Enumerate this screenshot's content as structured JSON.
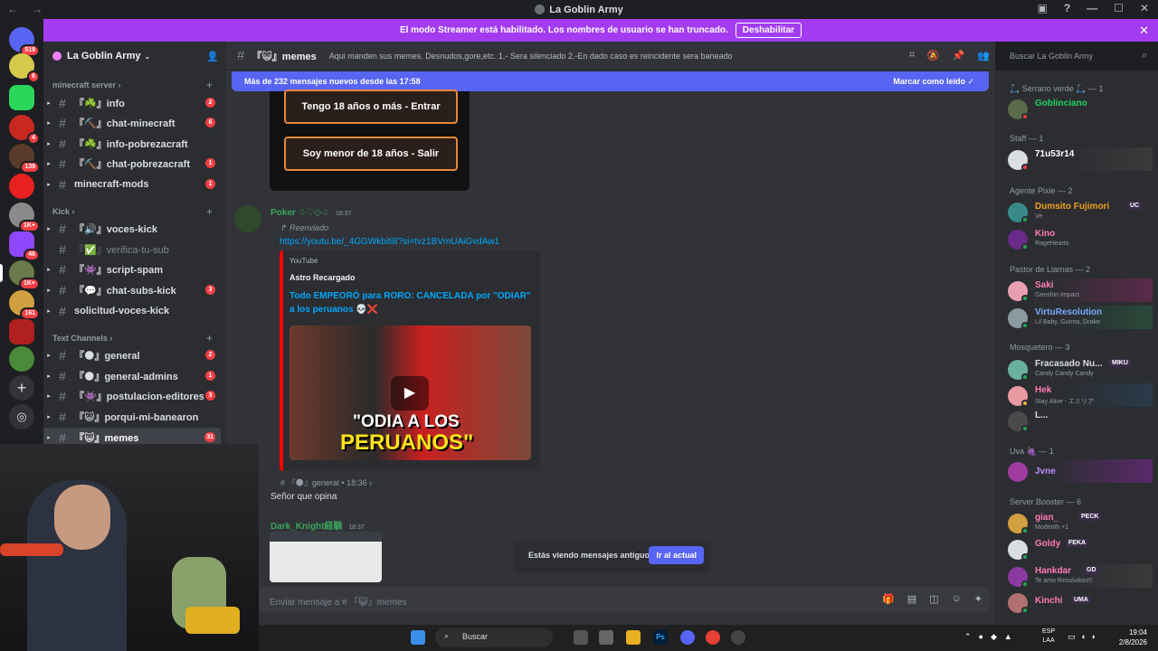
{
  "window": {
    "title": "La Goblin Army"
  },
  "streamer_banner": {
    "text": "El modo Streamer está habilitado. Los nombres de usuario se han truncado.",
    "button": "Deshabilitar"
  },
  "server_rail": [
    {
      "badge": "519"
    },
    {
      "badge": "6"
    },
    {
      "badge": ""
    },
    {
      "badge": "4"
    },
    {
      "badge": "139"
    },
    {
      "badge": ""
    },
    {
      "badge": "1K+"
    },
    {
      "badge": "46"
    },
    {
      "badge": "1K+"
    },
    {
      "badge": "161"
    },
    {
      "badge": ""
    },
    {
      "badge": ""
    }
  ],
  "server": {
    "name": "La Goblin Army"
  },
  "categories": {
    "minecraft": "minecraft server",
    "kick": "Kick",
    "text": "Text Channels"
  },
  "channels": [
    {
      "label": "『☘️』info",
      "count": "2"
    },
    {
      "label": "『⛏️』chat-minecraft",
      "count": "6"
    },
    {
      "label": "『☘️』info-pobrezacraft",
      "count": ""
    },
    {
      "label": "『⛏️』chat-pobrezacraft",
      "count": "1"
    },
    {
      "label": "minecraft-mods",
      "count": "1"
    },
    {
      "label": "『🔊』voces-kick",
      "count": ""
    },
    {
      "label": "『✅』verifica-tu-sub",
      "count": ""
    },
    {
      "label": "『👾』script-spam",
      "count": ""
    },
    {
      "label": "『💬』chat-subs-kick",
      "count": "3"
    },
    {
      "label": "solicitud-voces-kick",
      "count": ""
    },
    {
      "label": "『🌑』general",
      "count": "2"
    },
    {
      "label": "『🌑』general-admins",
      "count": "1"
    },
    {
      "label": "『👾』postulacion-editores",
      "count": "3"
    },
    {
      "label": "『😺』porqui-mi-banearon",
      "count": ""
    },
    {
      "label": "『😺』memes",
      "count": "31"
    }
  ],
  "chat_header": {
    "channel": "『😺』memes",
    "topic": "Aqui manden sus memes. Desnudos,gore,etc. 1.- Sera silenciado 2.-En dado caso es reincidente sera baneado"
  },
  "search": {
    "placeholder": "Buscar La Goblin Army"
  },
  "new_messages": {
    "text": "Más de 232 mensajes nuevos desde las 17:58",
    "action": "Marcar como leído"
  },
  "age_gate": {
    "adult": "Tengo 18 años o más - Entrar",
    "minor": "Soy menor de 18 años - Salir"
  },
  "messages": [
    {
      "author": "Poker ♧♡◇♤",
      "time": "18:37",
      "forwarded": "Reenviado",
      "link": "https://youtu.be/_4GGWkbiti8?si=tvz1BVmUAiGvdAw1",
      "embed": {
        "provider": "YouTube",
        "author": "Astro Recargado",
        "title": "Todo EMPEORÓ para RORO: CANCELADA por \"ODIAR\" a los peruanos 💀❌",
        "thumb_text_1": "\"ODIA A LOS",
        "thumb_text_2": "PERUANOS\""
      },
      "origin": "# 『🌑』general • 18:36 ›",
      "reply": "Señor que opina"
    },
    {
      "author": "Dark_Knight経験",
      "time": "18:37"
    }
  ],
  "old_messages": {
    "text": "Estás viendo mensajes antiguos",
    "button": "Ir al actual"
  },
  "composer": {
    "placeholder": "Enviar mensaje a # 『😺』memes"
  },
  "member_groups": [
    {
      "role": "🛴 Serrano verde 🛴 — 1",
      "members": [
        {
          "name": "Goblinciano",
          "status": "",
          "color": "#23d160"
        }
      ]
    },
    {
      "role": "Staff — 1",
      "members": [
        {
          "name": "71u53r14",
          "status": "",
          "color": "#ffffff"
        }
      ]
    },
    {
      "role": "Agente Pixie — 2",
      "members": [
        {
          "name": "Dumsito Fujimori",
          "status": "Ve",
          "color": "#f0a020",
          "tag": "UC"
        },
        {
          "name": "Kino",
          "status": "RageHearts",
          "color": "#ff7ab8"
        }
      ]
    },
    {
      "role": "Pastor de Llamas — 2",
      "members": [
        {
          "name": "Saki",
          "status": "Genshin Impact",
          "color": "#ff7ab8"
        },
        {
          "name": "VirtuResolution",
          "status": "Lil Baby, Gunna, Drake",
          "color": "#7aa8ff"
        }
      ]
    },
    {
      "role": "Mosquetero — 3",
      "members": [
        {
          "name": "Fracasado Nu...",
          "status": "Candy Candy Candy",
          "color": "#dbdee1",
          "tag": "MIKU"
        },
        {
          "name": "Hek",
          "status": "Stay Alive - エミリア",
          "color": "#ff7ab8"
        },
        {
          "name": "L...",
          "status": "",
          "color": "#dbdee1"
        }
      ]
    },
    {
      "role": "Uva 🍇 — 1",
      "members": [
        {
          "name": "Jvne",
          "status": "",
          "color": "#c28cff"
        }
      ]
    },
    {
      "role": "Server Booster — 6",
      "members": [
        {
          "name": "gian_",
          "status": "Modrinth +1",
          "color": "#ff7ab8",
          "tag": "PECK"
        },
        {
          "name": "Goldy",
          "status": "",
          "color": "#ff7ab8",
          "tag": "FEKA"
        },
        {
          "name": "Hankdar",
          "status": "Te amo Resolution!!!",
          "color": "#ff7ab8",
          "tag": "GD"
        },
        {
          "name": "Kinchi",
          "status": "",
          "color": "#ff7ab8",
          "tag": "UMA"
        }
      ]
    }
  ],
  "taskbar": {
    "search": "Buscar",
    "lang": "ESP\nLAA",
    "time": "19:04",
    "date": "2/8/2026"
  }
}
